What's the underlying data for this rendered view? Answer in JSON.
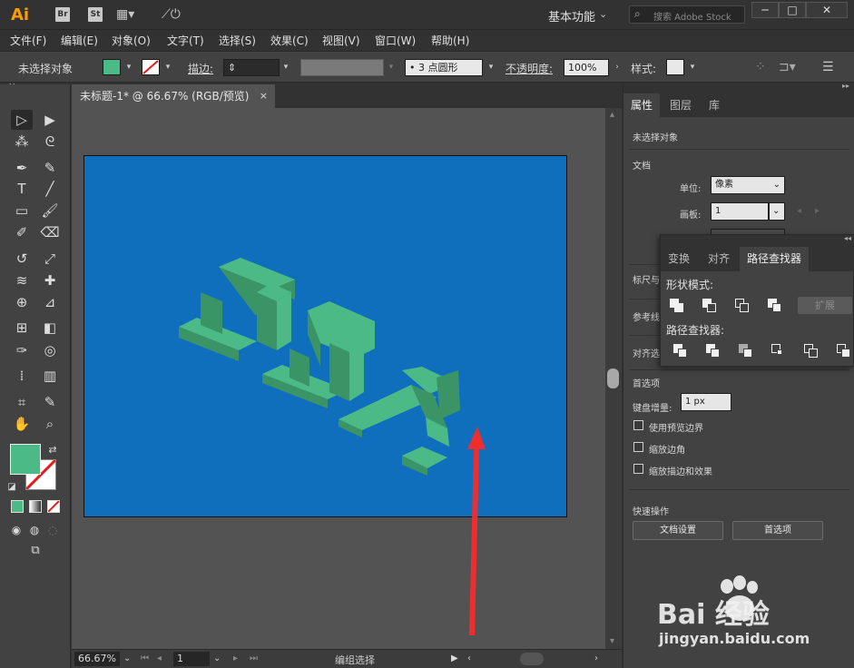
{
  "titlebar": {
    "app_logo": "Ai",
    "bridge": "Br",
    "stock": "St",
    "workspace": "基本功能",
    "search_placeholder": "搜索 Adobe Stock",
    "minimize": "─",
    "maximize": "□",
    "close": "✕"
  },
  "menu": [
    "文件(F)",
    "编辑(E)",
    "对象(O)",
    "文字(T)",
    "选择(S)",
    "效果(C)",
    "视图(V)",
    "窗口(W)",
    "帮助(H)"
  ],
  "control": {
    "selection": "未选择对象",
    "stroke_label": "描边:",
    "brush": "3 点圆形",
    "opacity_label": "不透明度:",
    "opacity_value": "100%",
    "style_label": "样式:",
    "fill_color": "#4cba87"
  },
  "document": {
    "tab_title": "未标题-1* @ 66.67% (RGB/预览)",
    "close": "×",
    "artboard_color": "#0f6fbd",
    "art_color_light": "#4cba87",
    "art_color_dark": "#3a9466"
  },
  "statusbar": {
    "zoom": "66.67%",
    "artboard": "1",
    "status": "编组选择"
  },
  "properties": {
    "tabs": [
      "属性",
      "图层",
      "库"
    ],
    "no_selection": "未选择对象",
    "doc_section": "文档",
    "unit_label": "单位:",
    "unit_value": "像素",
    "artboard_label": "画板:",
    "artboard_value": "1",
    "ruler_label": "标尺与",
    "guides_label": "参考线",
    "align_label": "对齐选",
    "prefs_section": "首选项",
    "key_inc_label": "键盘增量:",
    "key_inc_value": "1 px",
    "chk_preview_bounds": "使用预览边界",
    "chk_scale_corners": "缩放边角",
    "chk_scale_strokes": "缩放描边和效果",
    "quick_actions": "快速操作",
    "btn_doc_setup": "文档设置",
    "btn_prefs": "首选项"
  },
  "pathfinder": {
    "tabs": [
      "变换",
      "对齐",
      "路径查找器"
    ],
    "shape_modes": "形状模式:",
    "expand": "扩展",
    "pathfinders": "路径查找器:"
  },
  "watermark": {
    "text": "Bai  经验",
    "url": "jingyan.baidu.com"
  }
}
